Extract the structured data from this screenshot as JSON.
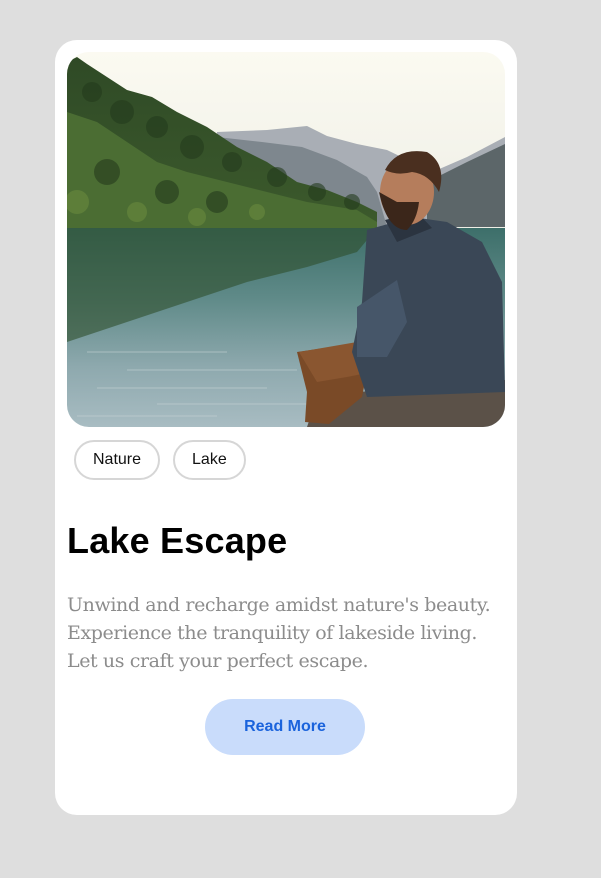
{
  "card": {
    "image_alt": "Man sitting on a rock by a mountain lake",
    "tags": [
      "Nature",
      "Lake"
    ],
    "title": "Lake Escape",
    "description": "Unwind and recharge amidst nature's beauty. Experience the tranquility of lakeside living. Let us craft your perfect escape.",
    "button_label": "Read More"
  },
  "colors": {
    "page_background": "#dedede",
    "card_background": "#ffffff",
    "button_background": "#c9dcfb",
    "button_text": "#1a63dc",
    "description_text": "#8c8c8c"
  }
}
